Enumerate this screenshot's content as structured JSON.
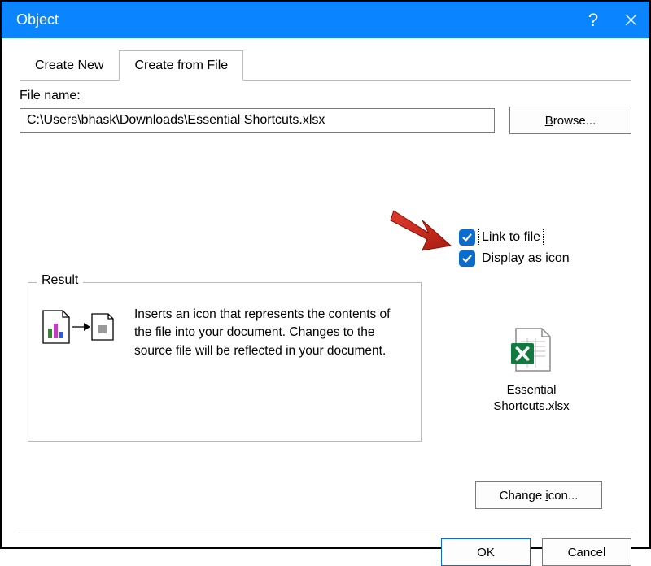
{
  "titlebar": {
    "title": "Object"
  },
  "tabs": {
    "create_new": "Create New",
    "create_from_file": "Create from File"
  },
  "file": {
    "label": "File name:",
    "value": "C:\\Users\\bhask\\Downloads\\Essential Shortcuts.xlsx",
    "browse": "Browse..."
  },
  "options": {
    "link_to_file": "Link to file",
    "display_as_icon": "Display as icon",
    "link_to_file_checked": true,
    "display_as_icon_checked": true
  },
  "result": {
    "legend": "Result",
    "text": "Inserts an icon that represents the contents of the file into your document. Changes to the source file will be reflected in your document."
  },
  "preview": {
    "file_label": "Essential Shortcuts.xlsx",
    "change_icon": "Change icon..."
  },
  "buttons": {
    "ok": "OK",
    "cancel": "Cancel"
  }
}
